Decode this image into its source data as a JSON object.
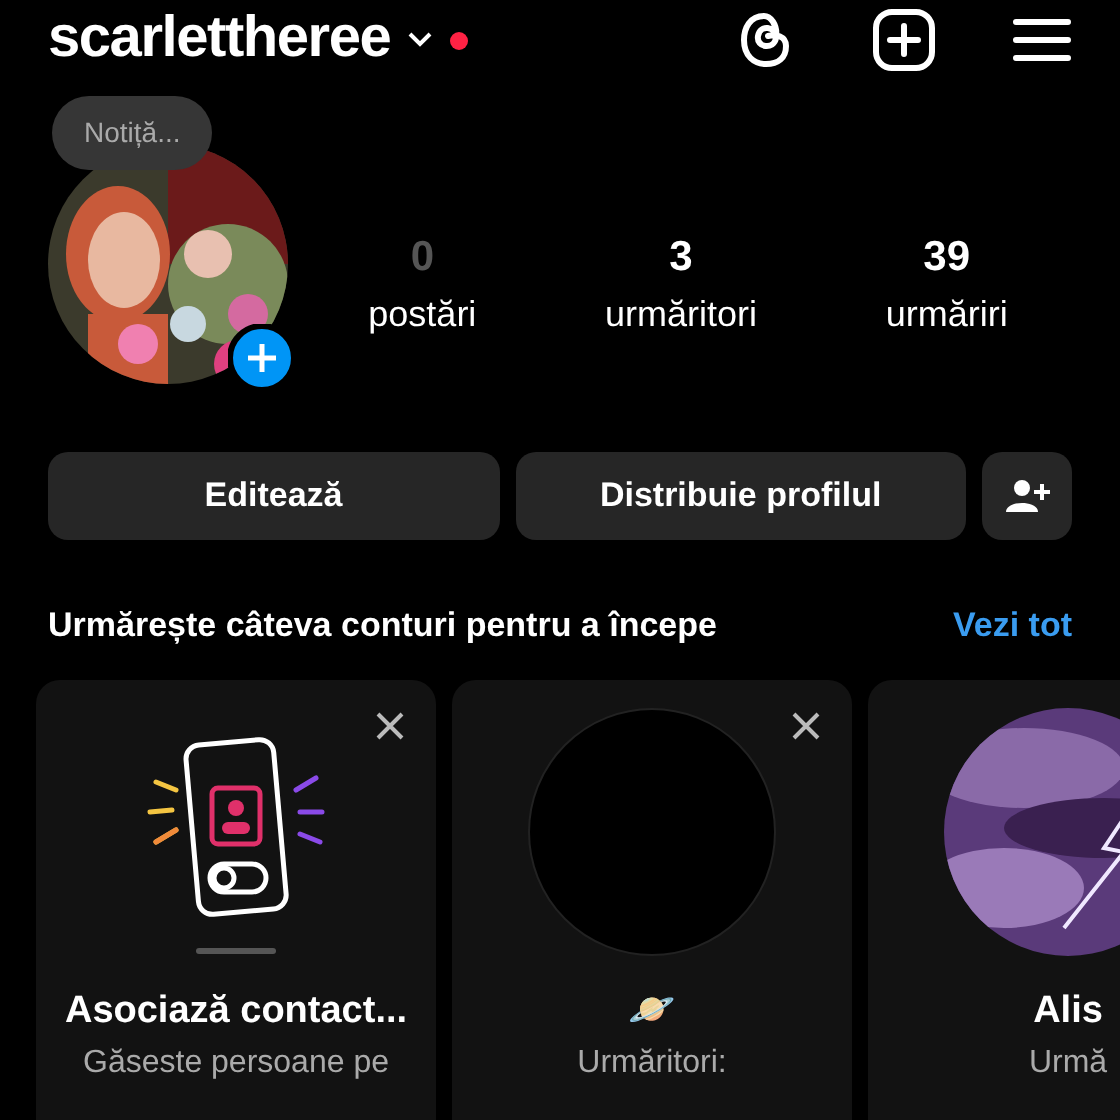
{
  "header": {
    "username": "scarlettheree",
    "has_notification": true
  },
  "note": {
    "placeholder": "Notiță..."
  },
  "stats": [
    {
      "value": "0",
      "label": "postări",
      "muted": true
    },
    {
      "value": "3",
      "label": "urmăritori",
      "muted": false
    },
    {
      "value": "39",
      "label": "urmăriri",
      "muted": false
    }
  ],
  "buttons": [
    "Editează",
    "Distribuie profilul"
  ],
  "suggestions": {
    "title": "Urmărește câteva conturi pentru a începe",
    "see_all": "Vezi tot",
    "cards": [
      {
        "kind": "contacts",
        "title": "Asociază contact...",
        "subtitle": "Găseste persoane pe",
        "dismissible": true
      },
      {
        "kind": "blank",
        "title": "🪐",
        "subtitle": "Urmăritori:",
        "dismissible": true
      },
      {
        "kind": "picture",
        "title": "Alis",
        "subtitle": "Urmă"
      }
    ]
  }
}
